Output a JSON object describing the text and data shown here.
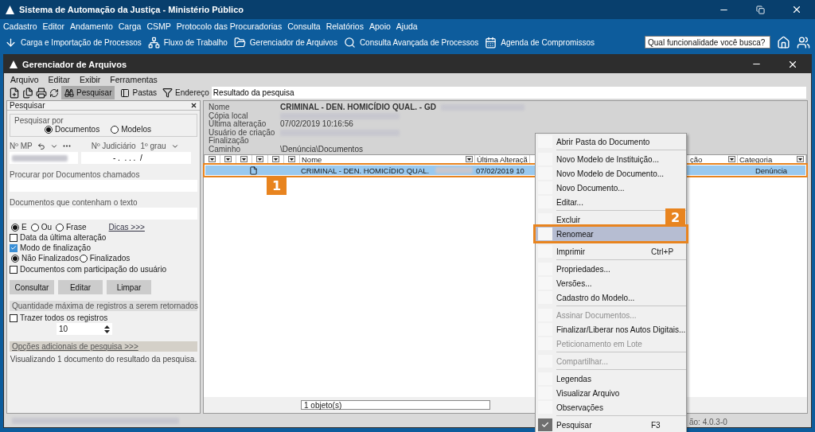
{
  "window": {
    "title": "Sistema de Automação da Justiça - Ministério Público"
  },
  "menu": [
    "Cadastro",
    "Editor",
    "Andamento",
    "Carga",
    "CSMP",
    "Protocolo das Procuradorias",
    "Consulta",
    "Relatórios",
    "Apoio",
    "Ajuda"
  ],
  "toolbar": [
    {
      "kind": "download",
      "label": "Carga e Importação de Processos"
    },
    {
      "kind": "flow",
      "label": "Fluxo de Trabalho"
    },
    {
      "kind": "folder",
      "label": "Gerenciador de Arquivos"
    },
    {
      "kind": "search",
      "label": "Consulta Avançada de Processos"
    },
    {
      "kind": "calendar",
      "label": "Agenda de Compromissos"
    }
  ],
  "search": {
    "placeholder": "Qual funcionalidade você busca?"
  },
  "file_manager": {
    "title": "Gerenciador de Arquivos",
    "menu": [
      "Arquivo",
      "Editar",
      "Exibir",
      "Ferramentas"
    ],
    "view_buttons": [
      {
        "kind": "binoculars",
        "label": "Pesquisar",
        "selected": true
      },
      {
        "kind": "folder",
        "label": "Pastas",
        "selected": false
      }
    ],
    "address_label": "Endereço",
    "address": "Resultado da pesquisa"
  },
  "search_panel": {
    "title": "Pesquisar",
    "search_by_label": "Pesquisar por",
    "search_by": [
      {
        "label": "Documentos",
        "selected": true
      },
      {
        "label": "Modelos",
        "selected": false
      }
    ],
    "mp_label": "Nº MP",
    "judicial_label": "Nº Judiciário",
    "instance": "1º grau",
    "judicial_value": "- .  . . .  /",
    "name_label": "Procurar por Documentos chamados",
    "text_label": "Documentos que contenham o texto",
    "match_modes": [
      {
        "label": "E",
        "selected": true
      },
      {
        "label": "Ou",
        "selected": false
      },
      {
        "label": "Frase",
        "selected": false
      }
    ],
    "tips_link": "Dicas >>>",
    "date_filter": {
      "label": "Data da última alteração",
      "checked": false
    },
    "finalization_filter": {
      "label": "Modo de finalização",
      "checked": true
    },
    "finalization_modes": [
      {
        "label": "Não Finalizados",
        "selected": true
      },
      {
        "label": "Finalizados",
        "selected": false
      }
    ],
    "participation_filter": {
      "label": "Documentos com participação do usuário",
      "checked": false
    },
    "buttons": [
      "Consultar",
      "Editar",
      "Limpar"
    ],
    "limit_section": "Quantidade máxima de registros a serem retornados",
    "all_records": {
      "label": "Trazer todos os registros",
      "checked": false
    },
    "limit": "10",
    "more_options": "Opções adicionais de pesquisa >>>",
    "result_note": "Visualizando 1 documento do resultado da pesquisa."
  },
  "details": [
    {
      "label": "Nome",
      "value": "CRIMINAL - DEN. HOMICÍDIO QUAL. - GD",
      "redacted": true
    },
    {
      "label": "Cópia local",
      "redacted": true
    },
    {
      "label": "Última alteração",
      "value": "07/02/2019 10:16:56",
      "redacted": false
    },
    {
      "label": "Usuário de criação",
      "redacted": true
    },
    {
      "label": "Finalização",
      "redacted": false
    },
    {
      "label": "Caminho",
      "value": "\\Denúncia\\Documentos",
      "redacted": false
    }
  ],
  "table": {
    "columns": [
      {
        "label": "Nome"
      },
      {
        "label": "Última Alteraçã"
      },
      {
        "label": "ção"
      },
      {
        "label": "Categoria"
      }
    ],
    "rows": [
      {
        "selected": true,
        "callout": "1",
        "name": "CRIMINAL - DEN. HOMICÍDIO QUAL.",
        "modified": "07/02/2019 10",
        "category": "Denúncia"
      }
    ],
    "footer": "1 objeto(s)"
  },
  "context_menu": [
    {
      "label": "Abrir Pasta do Documento",
      "disabled": false,
      "checked": false,
      "highlighted": false,
      "separator_after": true
    },
    {
      "label": "Novo Modelo de Instituição...",
      "disabled": false,
      "checked": false,
      "highlighted": false,
      "separator_after": false
    },
    {
      "label": "Novo Modelo de Documento...",
      "disabled": false,
      "checked": false,
      "highlighted": false,
      "separator_after": false
    },
    {
      "label": "Novo Documento...",
      "disabled": false,
      "checked": false,
      "highlighted": false,
      "separator_after": false
    },
    {
      "label": "Editar...",
      "disabled": false,
      "checked": false,
      "highlighted": false,
      "separator_after": true
    },
    {
      "label": "Excluir",
      "disabled": false,
      "checked": false,
      "highlighted": false,
      "separator_after": false
    },
    {
      "label": "Renomear",
      "disabled": false,
      "checked": false,
      "highlighted": true,
      "callout": "2",
      "separator_after": true
    },
    {
      "label": "Imprimir",
      "shortcut": "Ctrl+P",
      "disabled": false,
      "checked": false,
      "highlighted": false,
      "separator_after": true
    },
    {
      "label": "Propriedades...",
      "disabled": false,
      "checked": false,
      "highlighted": false,
      "separator_after": false
    },
    {
      "label": "Versões...",
      "disabled": false,
      "checked": false,
      "highlighted": false,
      "separator_after": false
    },
    {
      "label": "Cadastro do Modelo...",
      "disabled": false,
      "checked": false,
      "highlighted": false,
      "separator_after": true
    },
    {
      "label": "Assinar Documentos...",
      "disabled": true,
      "checked": false,
      "highlighted": false,
      "separator_after": false
    },
    {
      "label": "Finalizar/Liberar nos Autos Digitais...",
      "disabled": false,
      "checked": false,
      "highlighted": false,
      "separator_after": false
    },
    {
      "label": "Peticionamento em Lote",
      "disabled": true,
      "checked": false,
      "highlighted": false,
      "separator_after": true
    },
    {
      "label": "Compartilhar...",
      "disabled": true,
      "checked": false,
      "highlighted": false,
      "separator_after": true
    },
    {
      "label": "Legendas",
      "disabled": false,
      "checked": false,
      "highlighted": false,
      "separator_after": false
    },
    {
      "label": "Visualizar Arquivo",
      "disabled": false,
      "checked": false,
      "highlighted": false,
      "separator_after": false
    },
    {
      "label": "Observações",
      "disabled": false,
      "checked": false,
      "highlighted": false,
      "separator_after": true
    },
    {
      "label": "Pesquisar",
      "shortcut": "F3",
      "disabled": false,
      "checked": true,
      "highlighted": false,
      "separator_after": false
    }
  ],
  "status_bar": {
    "version": "ão: 4.0.3-0"
  }
}
